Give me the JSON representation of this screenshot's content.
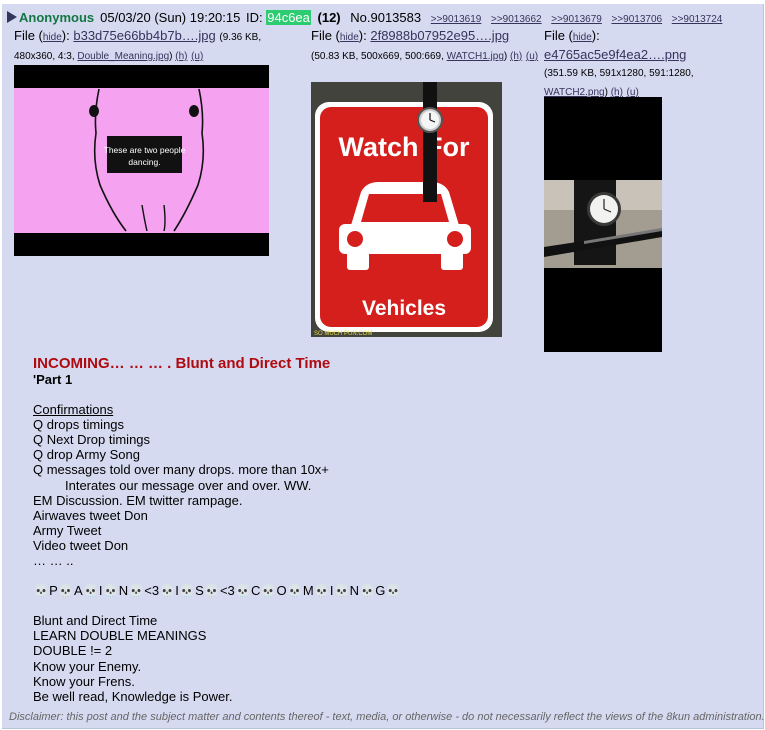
{
  "header": {
    "name": "Anonymous",
    "date": "05/03/20 (Sun) 19:20:15",
    "id_label": "ID:",
    "id_value": "94c6ea",
    "count": "(12)",
    "post_number": "No.9013583",
    "backlinks": [
      ">>9013619",
      ">>9013662",
      ">>9013679",
      ">>9013706",
      ">>9013724"
    ]
  },
  "files": [
    {
      "prefix": "File (",
      "hide": "hide",
      "mid": "): ",
      "name": "b33d75e66bb4b7b….jpg",
      "meta": "(9.36 KB, 480x360, 4:3, ",
      "orig": "Double_Meaning.jpg",
      "h": "(h)",
      "u": "(u)",
      "caption": "These are two people dancing."
    },
    {
      "prefix": "File (",
      "hide": "hide",
      "mid": "): ",
      "name": "2f8988b07952e95….jpg",
      "meta": "(50.83 KB, 500x669, 500:669, ",
      "orig": "WATCH1.jpg",
      "h": "(h)",
      "u": "(u)",
      "sign_top": "Watch For",
      "sign_bottom": "Vehicles",
      "watermark": "SO MUCH PUN.COM"
    },
    {
      "prefix": "File (",
      "hide": "hide",
      "mid": "):",
      "name": "e4765ac5e9f4ea2….png",
      "meta": "(351.59 KB, 591x1280, 591:1280, ",
      "orig": "WATCH2.png",
      "h": "(h)",
      "u": "(u)"
    }
  ],
  "body": {
    "title": "INCOMING… … … . Blunt and Direct Time",
    "part": "'Part 1",
    "confirm_heading": "Confirmations",
    "lines1": [
      "Q drops timings",
      "Q Next Drop timings",
      "Q drop Army Song",
      "Q messages told over many drops. more than 10x+"
    ],
    "indent_line": "Interates our message over and over. WW.",
    "lines2": [
      "EM Discussion. EM twitter rampage.",
      "Airwaves tweet Don",
      "Army Tweet",
      "Video tweet Don",
      "… … .."
    ],
    "skull_line": "💀P💀A💀I💀N💀<3💀I💀S💀<3💀C💀O💀M💀I💀N💀G💀",
    "lines3": [
      "Blunt and Direct Time",
      "LEARN DOUBLE MEANINGS",
      "DOUBLE != 2",
      "Know your Enemy.",
      "Know your Frens.",
      "Be well read, Knowledge is Power."
    ]
  },
  "disclaimer": "Disclaimer: this post and the subject matter and contents thereof - text, media, or otherwise - do not necessarily reflect the views of the 8kun administration."
}
